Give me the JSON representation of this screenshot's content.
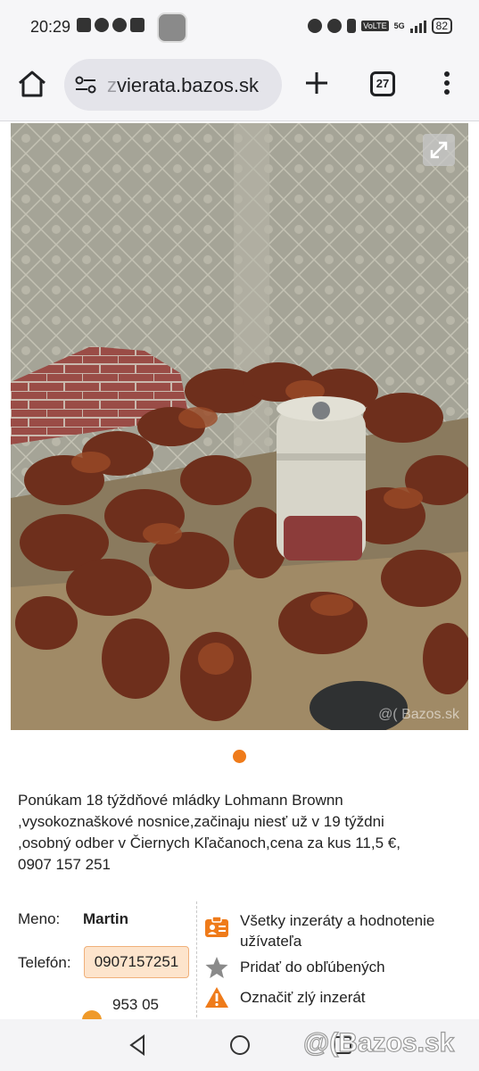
{
  "status_bar": {
    "time": "20:29",
    "left_icons": [
      "nfc-icon",
      "chat-icon",
      "facebook-icon",
      "youtube-icon"
    ],
    "right_icons": [
      "alarm-icon",
      "headset-icon",
      "sim-icon",
      "volte-icon",
      "signal-icon"
    ],
    "volte_label": "VoLTE",
    "network_label": "5G",
    "battery": "82"
  },
  "browser": {
    "url_prefix": "z",
    "url_rest": "vierata.bazos.sk",
    "tab_count": "27"
  },
  "gallery": {
    "watermark": "@( Bazos.sk",
    "active_dot_color": "#ef7b1a"
  },
  "listing": {
    "description": "Ponúkam 18 týždňové mládky Lohmann Brownn\n,vysokoznaškové nosnice,začinaju niesť už v 19 týždni\n,osobný odber v Čiernych Kľačanoch,cena za kus 11,5 €,\n0907 157 251",
    "name_label": "Meno:",
    "name_value": "Martin",
    "phone_label": "Telefón:",
    "phone_value": "0907157251",
    "postcode": "953 05"
  },
  "actions": [
    {
      "label": "Všetky inzeráty a hodnotenie užívateľa",
      "icon": "user-card-icon"
    },
    {
      "label": "Pridať do obľúbených",
      "icon": "star-icon"
    },
    {
      "label": "Označiť zlý inzerát",
      "icon": "warning-icon"
    }
  ],
  "overlay_brand": "@(Bazos.sk"
}
